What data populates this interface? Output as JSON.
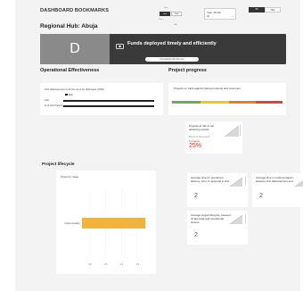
{
  "header": {
    "title": "DASHBOARD BOOKMARKS",
    "hub": "Regional Hub: Abuja"
  },
  "view_toggle": {
    "top_caption": "View",
    "options": [
      "Grid",
      "Table"
    ],
    "active_index": 0,
    "bottom_captions": [
      "Focus",
      "Hub"
    ]
  },
  "year_filter": {
    "label": "Year, Month",
    "value": "All"
  },
  "segment_toggle": {
    "options": [
      "All",
      "Hub"
    ],
    "active_index": 0
  },
  "hero": {
    "letter": "D",
    "text": "Funds deployed timely and efficiently",
    "button_label": "Operational effectiveness"
  },
  "operational_effectiveness": {
    "title": "Operational Effectiveness",
    "card_title": "UoF disbursement or funds yet to be disbursed (USD)",
    "legend_label": "Risk",
    "rows": [
      {
        "label": "Hub",
        "value": 0.98
      },
      {
        "label": "% of UoF Planning",
        "value": 0.98
      }
    ]
  },
  "project_progress": {
    "title": "Project progress",
    "ontrack_title": "Projects on track against planned outputs and outcomes",
    "risk_card": {
      "title": "Projects at risk of not achieving results",
      "sub": "Based on latest report",
      "count": "6 projects",
      "value": "25%"
    }
  },
  "project_lifecycle": {
    "title": "Project lifecycle",
    "chart_title": "Project by stage",
    "kpis": [
      {
        "title": "Average time for operations delivery, from IC approval to first",
        "value": "2"
      },
      {
        "title": "Average time in implementation, between first disbursement and",
        "value": "2"
      },
      {
        "title": "Average project lifecycle, between IC approval and operational closure",
        "value": "2"
      }
    ]
  },
  "chart_data": {
    "type": "bar",
    "orientation": "horizontal",
    "title": "Project by stage",
    "categories": [
      "Implementation"
    ],
    "values": [
      4
    ],
    "xlim": [
      0,
      4
    ],
    "x_ticks": [
      "0.0",
      "0.5",
      "1.0",
      "1.5"
    ],
    "colors": [
      "#f2b33d"
    ]
  },
  "colors": {
    "hero_bg": "#3a3a3a",
    "hero_left": "#8a8a8a",
    "bar": "#f2b33d",
    "risk_red": "#c8352c",
    "ontrack_green": "#6ab04c",
    "ontrack_yellow": "#f0c419",
    "ontrack_orange": "#e67e22",
    "ontrack_red": "#d9453a"
  }
}
